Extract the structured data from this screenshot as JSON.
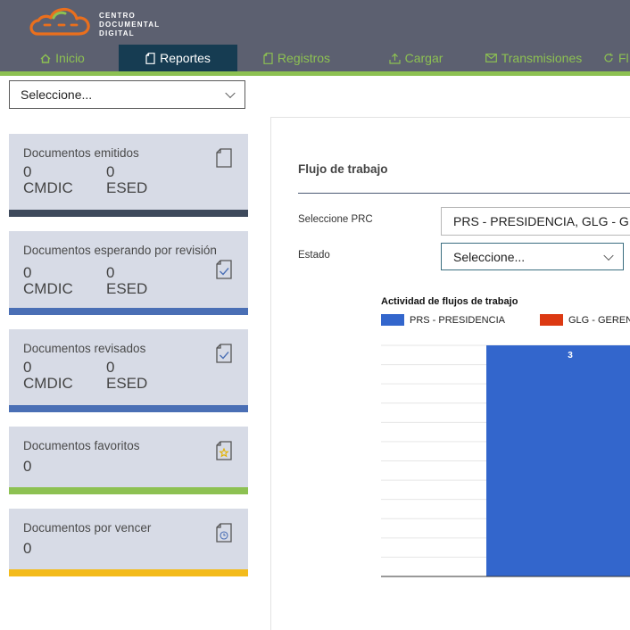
{
  "brand": {
    "line1": "CENTRO",
    "line2": "DOCUMENTAL",
    "line3": "DIGITAL"
  },
  "colors": {
    "header": "#5c6070",
    "active_tab": "#163c52",
    "nav_text": "#8dc152",
    "accent_line": "#8dc152",
    "card_bg": "#d7dbe6"
  },
  "nav": {
    "items": [
      {
        "label": "Inicio",
        "icon": "home-icon",
        "active": false
      },
      {
        "label": "Reportes",
        "icon": "document-icon",
        "active": true
      },
      {
        "label": "Registros",
        "icon": "document-icon",
        "active": false
      },
      {
        "label": "Cargar",
        "icon": "upload-icon",
        "active": false
      },
      {
        "label": "Transmisiones",
        "icon": "mail-icon",
        "active": false
      },
      {
        "label": "Fl",
        "icon": "refresh-icon",
        "active": false
      }
    ]
  },
  "top_select": {
    "value": "Seleccione..."
  },
  "cards": [
    {
      "title": "Documentos emitidos",
      "icon": "document-icon",
      "bar_color": "#3e4a5c",
      "stats": [
        {
          "value": "0",
          "label": "CMDIC"
        },
        {
          "value": "0",
          "label": "ESED"
        }
      ]
    },
    {
      "title": "Documentos esperando por revisión",
      "icon": "document-check-icon",
      "bar_color": "#4a6fb5",
      "stats": [
        {
          "value": "0",
          "label": "CMDIC"
        },
        {
          "value": "0",
          "label": "ESED"
        }
      ]
    },
    {
      "title": "Documentos revisados",
      "icon": "document-check-icon",
      "bar_color": "#4a6fb5",
      "stats": [
        {
          "value": "0",
          "label": "CMDIC"
        },
        {
          "value": "0",
          "label": "ESED"
        }
      ]
    },
    {
      "title": "Documentos favoritos",
      "icon": "document-star-icon",
      "bar_color": "#8dc152",
      "value": "0"
    },
    {
      "title": "Documentos por vencer",
      "icon": "document-clock-icon",
      "bar_color": "#f3bb1c",
      "value": "0"
    }
  ],
  "workflow": {
    "title": "Flujo de trabajo",
    "prc_label": "Seleccione PRC",
    "prc_value": "PRS - PRESIDENCIA,  GLG - GERE",
    "estado_label": "Estado",
    "estado_value": "Seleccione..."
  },
  "chart_data": {
    "type": "bar",
    "title": "Actividad de flujos de trabajo",
    "series": [
      {
        "name": "PRS - PRESIDENCIA",
        "color": "#3366cc",
        "values": [
          3
        ]
      },
      {
        "name": "GLG - GEREN",
        "color": "#dc3912",
        "values": []
      }
    ],
    "data_labels": [
      "3"
    ],
    "ylim": [
      0,
      3
    ],
    "grid": true,
    "legend": "top"
  }
}
